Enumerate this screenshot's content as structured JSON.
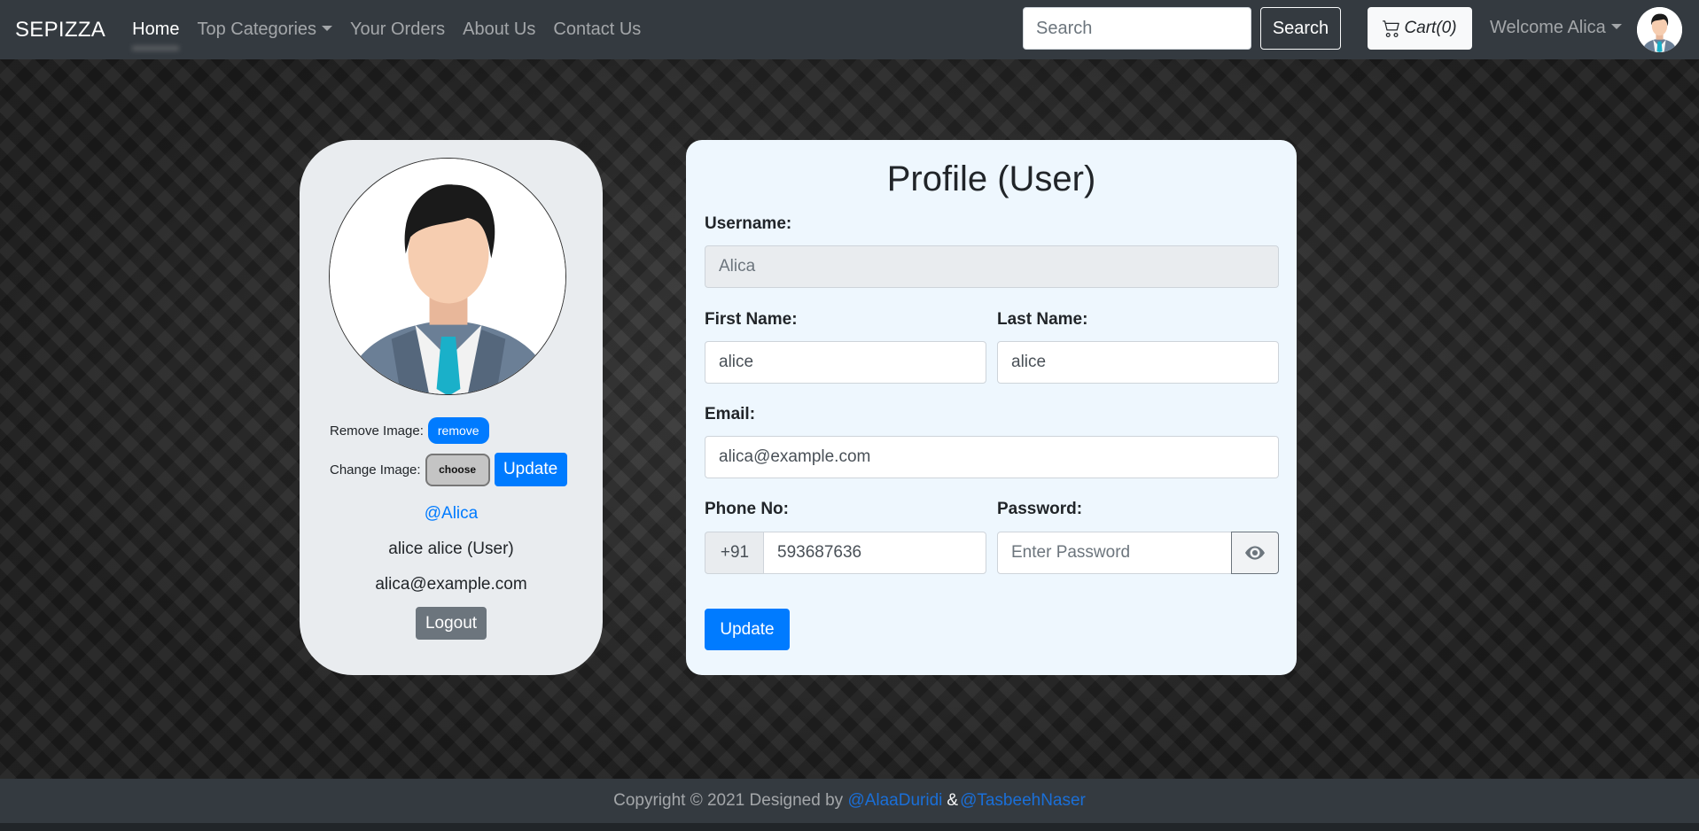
{
  "navbar": {
    "brand": "SEPIZZA",
    "links": [
      {
        "label": "Home",
        "active": true
      },
      {
        "label": "Top Categories",
        "dropdown": true
      },
      {
        "label": "Your Orders"
      },
      {
        "label": "About Us"
      },
      {
        "label": "Contact Us"
      }
    ],
    "search_placeholder": "Search",
    "search_button": "Search",
    "cart_label": "Cart(0)",
    "welcome_label": "Welcome Alica"
  },
  "profile_card": {
    "remove_image_label": "Remove Image:",
    "remove_button": "remove",
    "change_image_label": "Change Image:",
    "choose_button": "choose",
    "update_button": "Update",
    "handle": "@Alica",
    "full_name": "alice alice (User)",
    "email": "alica@example.com",
    "logout_button": "Logout"
  },
  "form": {
    "title": "Profile (User)",
    "username_label": "Username:",
    "username_value": "Alica",
    "first_name_label": "First Name:",
    "first_name_value": "alice",
    "last_name_label": "Last Name:",
    "last_name_value": "alice",
    "email_label": "Email:",
    "email_value": "alica@example.com",
    "phone_label": "Phone No:",
    "phone_prefix": "+91",
    "phone_value": "593687636",
    "password_label": "Password:",
    "password_placeholder": "Enter Password",
    "update_button": "Update"
  },
  "footer": {
    "text": "Copyright © 2021 Designed by",
    "author1": "@AlaaDuridi",
    "separator": "&",
    "author2": "@TasbeehNaser"
  },
  "colors": {
    "navbar": "#343a40",
    "primary": "#007bff",
    "secondary": "#6c757d",
    "form_card": "#eef7fe",
    "profile_card": "#e9ecef"
  },
  "icons": {
    "cart": "cart-icon",
    "eye": "eye-icon",
    "avatar": "avatar-icon"
  }
}
